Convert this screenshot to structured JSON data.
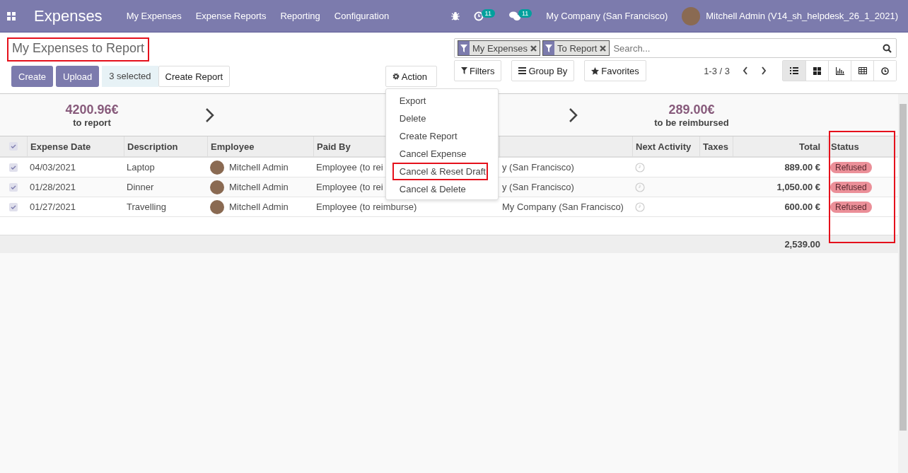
{
  "navbar": {
    "app_name": "Expenses",
    "menu": [
      "My Expenses",
      "Expense Reports",
      "Reporting",
      "Configuration"
    ],
    "activity_count": "11",
    "message_count": "11",
    "company": "My Company (San Francisco)",
    "user": "Mitchell Admin (V14_sh_helpdesk_26_1_2021)"
  },
  "control_panel": {
    "title": "My Expenses to Report",
    "title_highlighted": true,
    "buttons": [
      "Create",
      "Upload"
    ],
    "selected_count": "3 selected",
    "create_report": "Create Report",
    "action": "Action",
    "facets": [
      "My Expenses",
      "To Report"
    ],
    "search": {
      "placeholder": "Search..."
    },
    "filters": "Filters",
    "group_by": "Group By",
    "favorites": "Favorites",
    "pager": "1-3 / 3",
    "views": [
      {
        "kind": "list",
        "selected": true
      },
      {
        "kind": "kanban",
        "selected": false
      },
      {
        "kind": "graph",
        "selected": false
      },
      {
        "kind": "pivot",
        "selected": false
      },
      {
        "kind": "activity",
        "selected": false
      }
    ]
  },
  "action_menu": [
    {
      "label": "Export",
      "highlighted": false
    },
    {
      "label": "Delete",
      "highlighted": false
    },
    {
      "label": "Create Report",
      "highlighted": false
    },
    {
      "label": "Cancel Expense",
      "highlighted": false
    },
    {
      "label": "Cancel & Reset Draft",
      "highlighted": true
    },
    {
      "label": "Cancel & Delete",
      "highlighted": false
    }
  ],
  "stats": [
    {
      "amount": "4200.96€",
      "label": "to report"
    },
    {
      "amount": "289.00€",
      "label": "to be reimbursed"
    }
  ],
  "table": {
    "all_checked": true,
    "columns": [
      "Expense Date",
      "Description",
      "Employee",
      "Paid By",
      "",
      "Next Activity",
      "Taxes",
      "Total",
      "Status"
    ],
    "status_highlighted": true,
    "rows": [
      {
        "checked": true,
        "date": "04/03/2021",
        "description": "Laptop",
        "employee": "Mitchell Admin",
        "paid_by": "Employee (to rei",
        "company": "y (San Francisco)",
        "total": "889.00 €",
        "status": "Refused"
      },
      {
        "checked": true,
        "date": "01/28/2021",
        "description": "Dinner",
        "employee": "Mitchell Admin",
        "paid_by": "Employee (to rei",
        "company": "y (San Francisco)",
        "total": "1,050.00 €",
        "status": "Refused"
      },
      {
        "checked": true,
        "date": "01/27/2021",
        "description": "Travelling",
        "employee": "Mitchell Admin",
        "paid_by": "Employee (to reimburse)",
        "company": "My Company (San Francisco)",
        "total": "600.00 €",
        "status": "Refused"
      }
    ],
    "sum_total": "2,539.00"
  }
}
